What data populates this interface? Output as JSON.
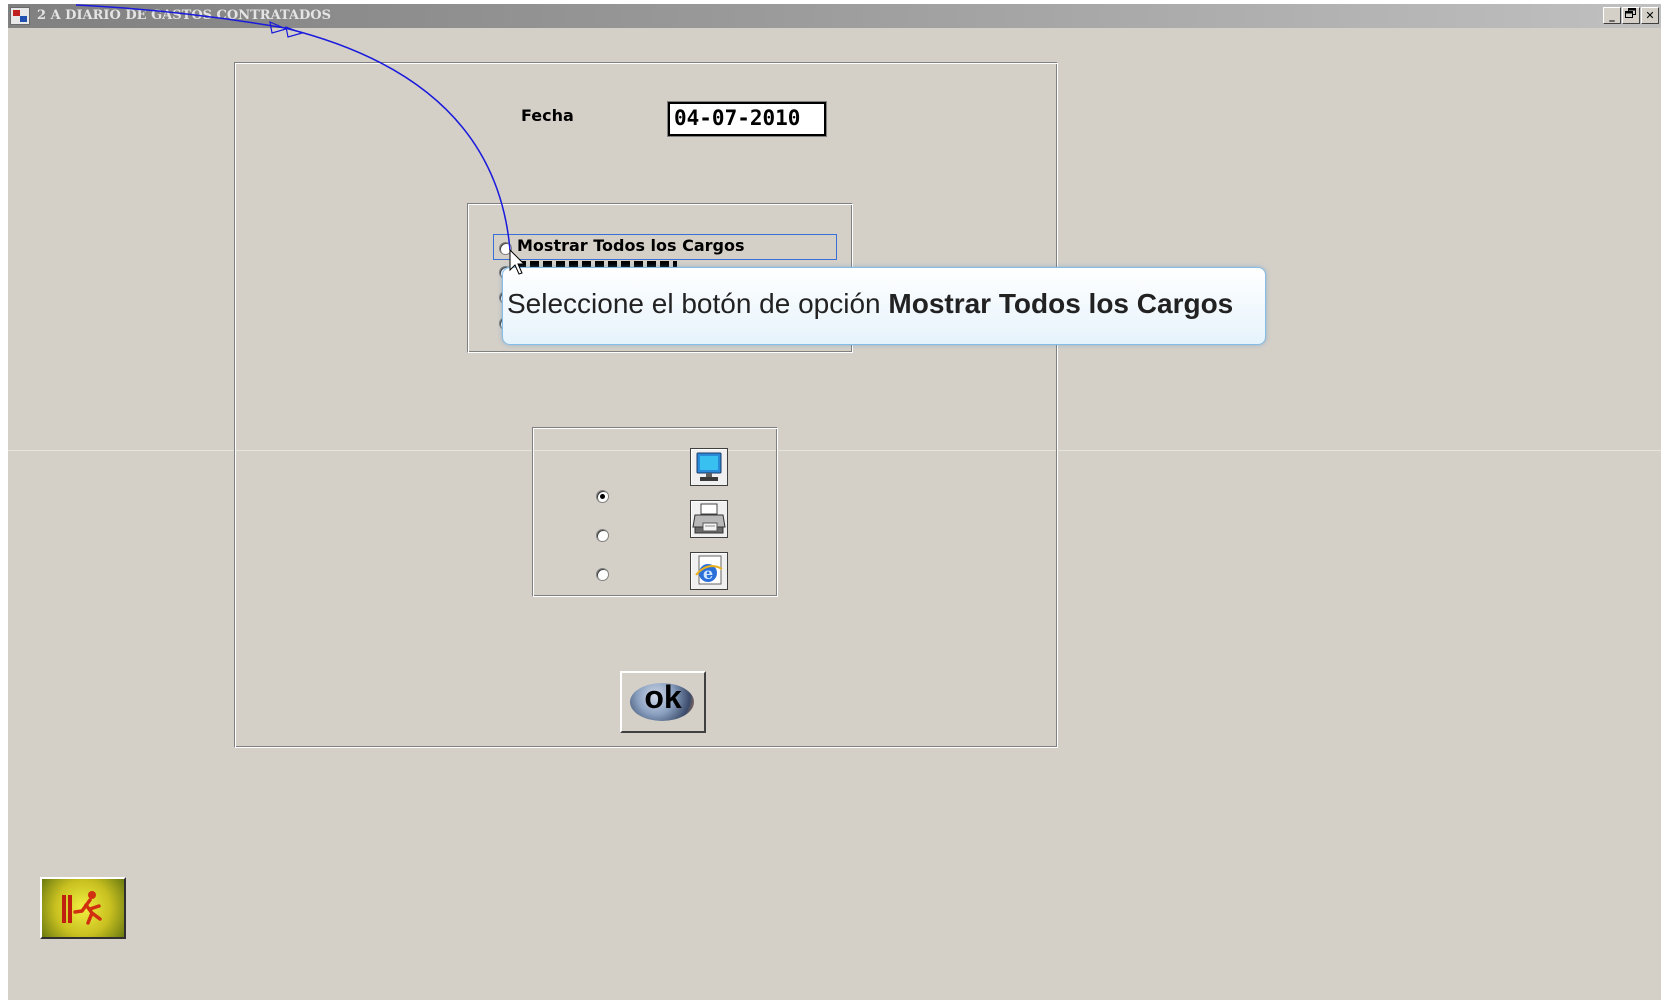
{
  "window": {
    "title": "2 A DIARIO DE GASTOS CONTRATADOS",
    "controls": {
      "minimize": "_",
      "restore": "🗗",
      "close": "✕"
    }
  },
  "form": {
    "fecha_label": "Fecha",
    "fecha_value": "04-07-2010"
  },
  "options": {
    "items": [
      {
        "label": "Mostrar Todos los Cargos",
        "selected": false,
        "highlighted": true
      }
    ]
  },
  "tooltip": {
    "text_prefix": "Seleccione el botón de opción ",
    "text_bold": "Mostrar Todos los Cargos"
  },
  "output": {
    "selected_index": 0,
    "destinations": [
      {
        "icon": "monitor-icon"
      },
      {
        "icon": "printer-icon"
      },
      {
        "icon": "internet-explorer-icon"
      }
    ]
  },
  "buttons": {
    "ok_label": "ok",
    "exit_icon": "exit-door-icon"
  },
  "colors": {
    "window_bg": "#d4d0c8",
    "tooltip_border": "#86bde6",
    "mouse_path": "#1a1adc",
    "highlight_border": "#3a6fd8"
  }
}
